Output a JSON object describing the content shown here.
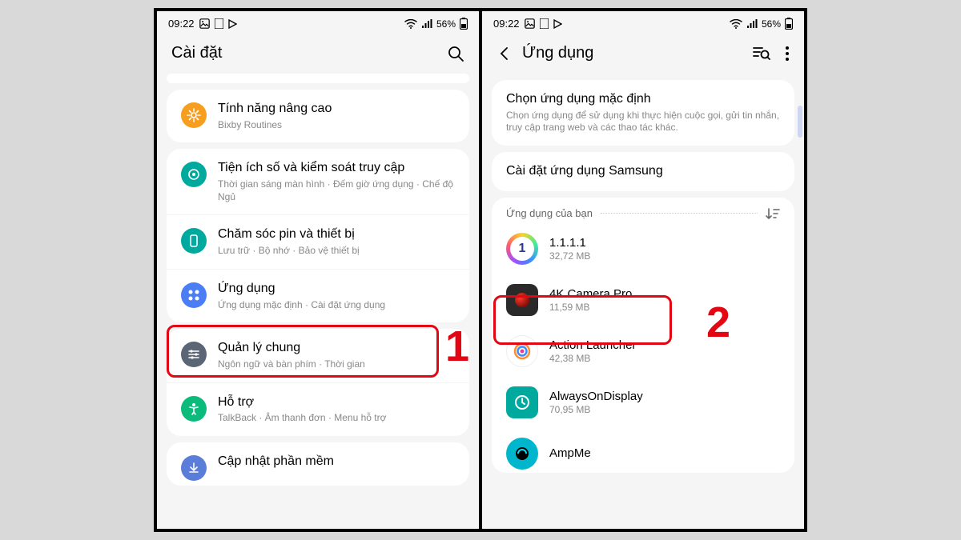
{
  "status": {
    "time": "09:22",
    "battery": "56%"
  },
  "left": {
    "title": "Cài đặt",
    "items": [
      {
        "name": "advanced",
        "title": "Tính năng nâng cao",
        "sub": "Bixby Routines",
        "icon": "gear",
        "bg": "#f79e1f"
      },
      {
        "name": "digital-wellbeing",
        "title": "Tiện ích số và kiểm soát truy cập",
        "sub": "Thời gian sáng màn hình · Đếm giờ ứng dụng · Chế độ Ngủ",
        "icon": "wellbeing",
        "bg": "#00a99e"
      },
      {
        "name": "battery-care",
        "title": "Chăm sóc pin và thiết bị",
        "sub": "Lưu trữ · Bộ nhớ · Bảo vệ thiết bị",
        "icon": "device",
        "bg": "#00a99e"
      },
      {
        "name": "apps",
        "title": "Ứng dụng",
        "sub": "Ứng dụng mặc định · Cài đặt ứng dụng",
        "icon": "apps",
        "bg": "#4b7df5"
      },
      {
        "name": "general",
        "title": "Quản lý chung",
        "sub": "Ngôn ngữ và bàn phím · Thời gian",
        "icon": "sliders",
        "bg": "#5a6575"
      },
      {
        "name": "accessibility",
        "title": "Hỗ trợ",
        "sub": "TalkBack · Âm thanh đơn · Menu hỗ trợ",
        "icon": "accessibility",
        "bg": "#0abb7b"
      },
      {
        "name": "update",
        "title": "Cập nhật phần mềm",
        "sub": "",
        "icon": "download",
        "bg": "#5a7dd9"
      }
    ],
    "step": "1"
  },
  "right": {
    "title": "Ứng dụng",
    "defaultCard": {
      "title": "Chọn ứng dụng mặc định",
      "sub": "Chọn ứng dụng để sử dụng khi thực hiện cuộc gọi, gửi tin nhắn, truy cập trang web và các thao tác khác."
    },
    "samsungCard": {
      "title": "Cài đặt ứng dụng Samsung"
    },
    "appsHeader": "Ứng dụng của bạn",
    "apps": [
      {
        "name": "1111",
        "title": "1.1.1.1",
        "sub": "32,72 MB",
        "iconType": "one"
      },
      {
        "name": "4kcamera",
        "title": "4K Camera Pro",
        "sub": "11,59 MB",
        "iconType": "camera"
      },
      {
        "name": "actionlauncher",
        "title": "Action Launcher",
        "sub": "42,38 MB",
        "iconType": "action"
      },
      {
        "name": "alwayson",
        "title": "AlwaysOnDisplay",
        "sub": "70,95 MB",
        "iconType": "clock"
      },
      {
        "name": "ampme",
        "title": "AmpMe",
        "sub": "",
        "iconType": "amp"
      }
    ],
    "step": "2"
  }
}
